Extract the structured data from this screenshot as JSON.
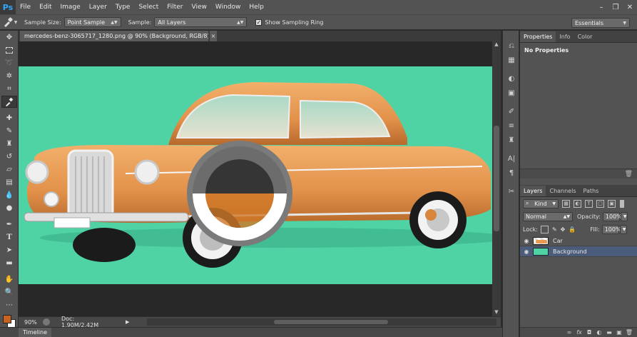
{
  "app": {
    "logo": "Ps"
  },
  "menu": [
    "File",
    "Edit",
    "Image",
    "Layer",
    "Type",
    "Select",
    "Filter",
    "View",
    "Window",
    "Help"
  ],
  "window_controls": {
    "minimize": "–",
    "restore": "❐",
    "close": "✕"
  },
  "options": {
    "sample_size_label": "Sample Size:",
    "sample_size_value": "Point Sample",
    "sample_label": "Sample:",
    "sample_value": "All Layers",
    "show_ring_label": "Show Sampling Ring",
    "show_ring_checked": true,
    "workspace": "Essentials"
  },
  "document": {
    "tab_title": "mercedes-benz-3065717_1280.png @ 90% (Background, RGB/8) *",
    "close": "×",
    "background_color": "#4fd3a5",
    "car_color": "#e99a4f"
  },
  "status": {
    "zoom": "90%",
    "doc_size": "Doc: 1.90M/2.42M",
    "arrow": "▶"
  },
  "timeline": {
    "label": "Timeline"
  },
  "panels": {
    "top_tabs": [
      "Properties",
      "Info",
      "Color"
    ],
    "active_top_tab": "Properties",
    "properties_text": "No Properties",
    "layer_tabs": [
      "Layers",
      "Channels",
      "Paths"
    ],
    "kind_label": "Kind",
    "blend_mode": "Normal",
    "opacity_label": "Opacity:",
    "opacity_value": "100%",
    "lock_label": "Lock:",
    "fill_label": "Fill:",
    "fill_value": "100%",
    "layers": [
      {
        "name": "Car",
        "visible": true,
        "selected": false
      },
      {
        "name": "Background",
        "visible": true,
        "selected": true
      }
    ]
  },
  "colors": {
    "foreground": "#c8621f",
    "background": "#ffffff",
    "sampling_ring_top": "#6c6c6c",
    "sampling_ring_bottom": "#ffffff"
  }
}
